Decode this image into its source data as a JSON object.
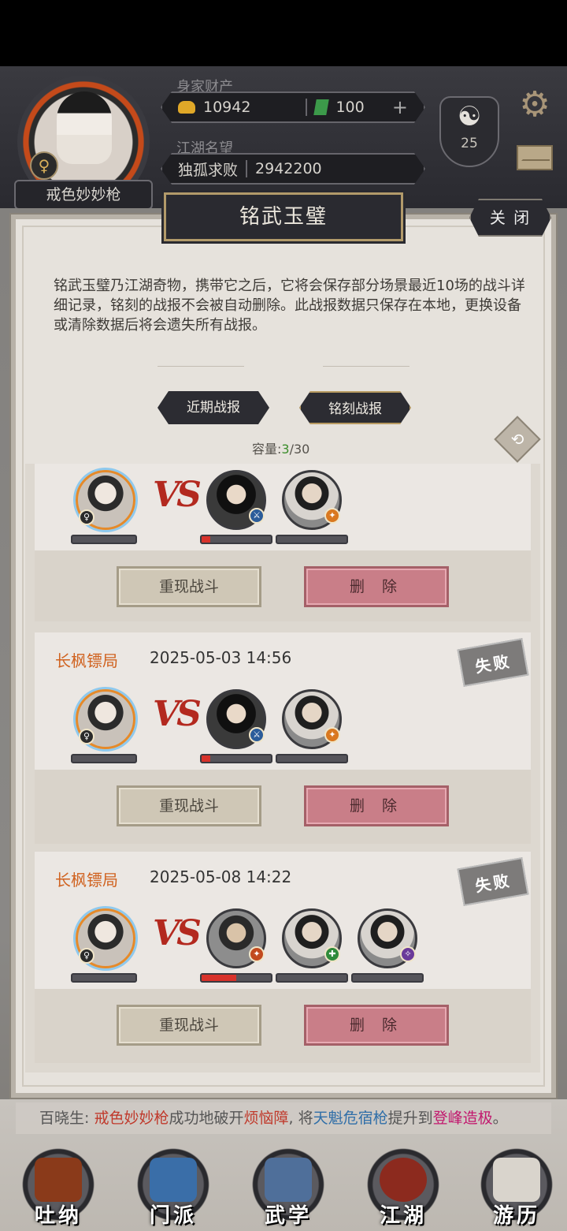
{
  "hud": {
    "wealth_label": "身家财产",
    "gold": "10942",
    "jade": "100",
    "fame_label": "江湖名望",
    "title": "独孤求败",
    "fame": "2942200",
    "player_name": "戒色妙妙枪",
    "level": "25"
  },
  "modal": {
    "title": "铭武玉璧",
    "close_label": "关 闭",
    "description": "铭武玉璧乃江湖奇物，携带它之后，它将会保存部分场景最近10场的战斗详细记录，铭刻的战报不会被自动删除。此战报数据只保存在本地，更换设备或清除数据后将会遗失所有战报。",
    "tabs": [
      {
        "label": "近期战报",
        "active": false
      },
      {
        "label": "铭刻战报",
        "active": true
      }
    ],
    "capacity_label": "容量:",
    "capacity_used": "3",
    "capacity_total": "/30"
  },
  "records": [
    {
      "title": "",
      "time": "",
      "result": "",
      "vs": "VS",
      "replay_label": "重现战斗",
      "delete_label": "删 除"
    },
    {
      "title": "长枫镖局",
      "time": "2025-05-03 14:56",
      "result": "失败",
      "vs": "VS",
      "replay_label": "重现战斗",
      "delete_label": "删 除"
    },
    {
      "title": "长枫镖局",
      "time": "2025-05-08 14:22",
      "result": "失败",
      "vs": "VS",
      "replay_label": "重现战斗",
      "delete_label": "删 除"
    }
  ],
  "news": {
    "prefix": "百晓生: ",
    "player": "戒色妙妙枪",
    "text1": "成功地破开",
    "obstacle": "烦恼障",
    "text2": ", 将",
    "skill": "天魁危宿枪",
    "text3": "提升到",
    "rank": "登峰造极",
    "suffix": "。"
  },
  "nav": [
    {
      "label": "吐纳",
      "icon": "meditation-icon"
    },
    {
      "label": "门派",
      "icon": "sect-icon"
    },
    {
      "label": "武学",
      "icon": "martial-book-icon"
    },
    {
      "label": "江湖",
      "icon": "jianghu-hat-icon"
    },
    {
      "label": "游历",
      "icon": "horse-icon"
    }
  ],
  "colors": {
    "accent_orange": "#d0621f",
    "hp_red": "#d8322b",
    "delete_pink": "#c97e88",
    "capacity_green": "#3b8d2b"
  }
}
